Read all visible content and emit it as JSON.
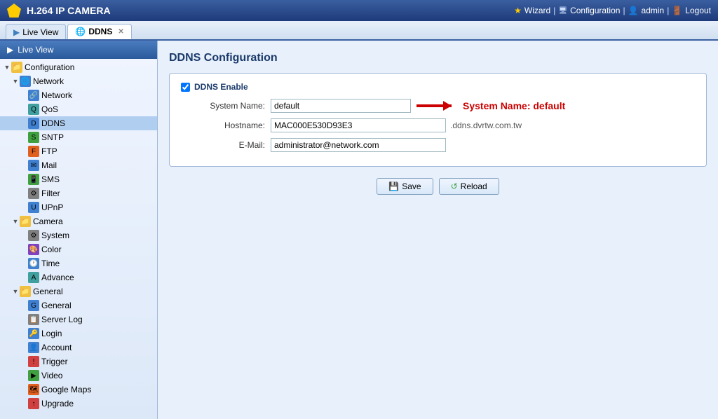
{
  "app": {
    "title": "H.264 IP CAMERA"
  },
  "header": {
    "title": "H.264 IP CAMERA",
    "wizard_label": "Wizard",
    "config_label": "Configuration",
    "admin_label": "admin",
    "logout_label": "Logout"
  },
  "tabbar": {
    "live_view_tab": "Live View",
    "ddns_tab": "DDNS"
  },
  "sidebar": {
    "live_view": "Live View",
    "configuration": "Configuration",
    "network_group": "Network",
    "network_item": "Network",
    "qos_item": "QoS",
    "ddns_item": "DDNS",
    "sntp_item": "SNTP",
    "ftp_item": "FTP",
    "mail_item": "Mail",
    "sms_item": "SMS",
    "filter_item": "Filter",
    "upnp_item": "UPnP",
    "camera_group": "Camera",
    "system_item": "System",
    "color_item": "Color",
    "time_item": "Time",
    "advance_item": "Advance",
    "general_group": "General",
    "general_item": "General",
    "server_log_item": "Server Log",
    "login_item": "Login",
    "account_item": "Account",
    "trigger_item": "Trigger",
    "video_item": "Video",
    "google_maps_item": "Google Maps",
    "upgrade_item": "Upgrade"
  },
  "content": {
    "page_title": "DDNS Configuration",
    "enable_label": "DDNS Enable",
    "system_name_label": "System Name:",
    "system_name_value": "default",
    "hostname_label": "Hostname:",
    "hostname_value": "MAC000E530D93E3",
    "hostname_suffix": ".ddns.dvrtw.com.tw",
    "email_label": "E-Mail:",
    "email_value": "administrator@network.com",
    "annotation_text": "System Name: default",
    "save_button": "Save",
    "reload_button": "Reload"
  }
}
